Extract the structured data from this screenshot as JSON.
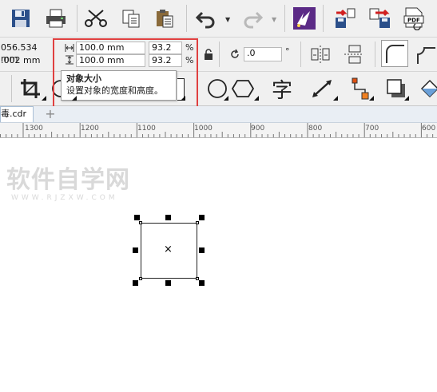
{
  "toolbar": {
    "icons": [
      "save-icon",
      "print-icon",
      "cut-icon",
      "copy-icon",
      "paste-icon",
      "undo-icon",
      "redo-icon",
      "corel-launcher-icon",
      "import-icon",
      "export-icon",
      "publish-pdf-icon"
    ],
    "pdf_label": "PDF"
  },
  "property_bar": {
    "x_value": "056.534 mm",
    "y_value": ".002 mm",
    "width_value": "100.0 mm",
    "height_value": "100.0 mm",
    "scale_x_value": "93.2",
    "scale_y_value": "93.2",
    "percent_symbol": "%",
    "rotation_value": ".0",
    "degree_symbol": "°"
  },
  "tooltip": {
    "title": "对象大小",
    "description": "设置对象的宽度和高度。"
  },
  "toolbox": {
    "text_tool_glyph": "字"
  },
  "document_tab": {
    "label": "毒.cdr",
    "add_label": "+"
  },
  "ruler": {
    "labels": [
      "1300",
      "1200",
      "1100",
      "1000",
      "900",
      "800",
      "700",
      "600"
    ]
  },
  "watermark": {
    "main": "软件自学网",
    "sub": "WWW.RJZXW.COM"
  },
  "colors": {
    "highlight": "#e04040",
    "toolbar_bg": "#f0f0f0",
    "launcher_purple": "#5b2a86"
  }
}
